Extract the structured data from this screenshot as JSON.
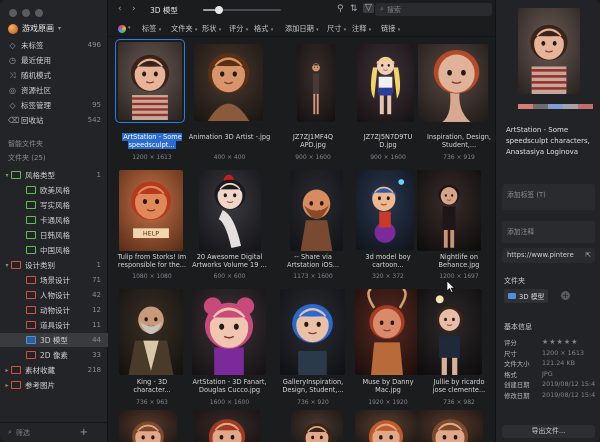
{
  "sidebar": {
    "library_name": "游戏原画",
    "nav": [
      {
        "label": "未标签",
        "count": "496",
        "icon": "tag"
      },
      {
        "label": "最近使用",
        "count": "",
        "icon": "clock"
      },
      {
        "label": "随机模式",
        "count": "",
        "icon": "shuffle"
      },
      {
        "label": "资源社区",
        "count": "",
        "icon": "globe"
      },
      {
        "label": "标签管理",
        "count": "95",
        "icon": "tag"
      },
      {
        "label": "回收站",
        "count": "542",
        "icon": "trash"
      }
    ],
    "smart_folders_title": "智能文件夹",
    "folders_title": "文件夹 (25)",
    "folders": [
      {
        "label": "风格类型",
        "count": "1",
        "arrow": "▾",
        "indent": 0,
        "color": "green"
      },
      {
        "label": "欧美风格",
        "count": "",
        "arrow": "",
        "indent": 1,
        "color": "green"
      },
      {
        "label": "写实风格",
        "count": "",
        "arrow": "",
        "indent": 1,
        "color": "green"
      },
      {
        "label": "卡通风格",
        "count": "",
        "arrow": "",
        "indent": 1,
        "color": "green"
      },
      {
        "label": "日韩风格",
        "count": "",
        "arrow": "",
        "indent": 1,
        "color": "green"
      },
      {
        "label": "中国风格",
        "count": "",
        "arrow": "",
        "indent": 1,
        "color": "green"
      },
      {
        "label": "设计类别",
        "count": "1",
        "arrow": "▾",
        "indent": 0,
        "color": "red"
      },
      {
        "label": "场景设计",
        "count": "71",
        "arrow": "",
        "indent": 1,
        "color": "red"
      },
      {
        "label": "人物设计",
        "count": "42",
        "arrow": "",
        "indent": 1,
        "color": "red"
      },
      {
        "label": "动物设计",
        "count": "12",
        "arrow": "",
        "indent": 1,
        "color": "red"
      },
      {
        "label": "道具设计",
        "count": "11",
        "arrow": "",
        "indent": 1,
        "color": "red"
      },
      {
        "label": "3D 模型",
        "count": "44",
        "arrow": "",
        "indent": 1,
        "color": "blue",
        "selected": true
      },
      {
        "label": "2D 像素",
        "count": "33",
        "arrow": "",
        "indent": 1,
        "color": "red"
      },
      {
        "label": "素材收藏",
        "count": "218",
        "arrow": "▸",
        "indent": 0,
        "color": "red"
      },
      {
        "label": "参考图片",
        "count": "",
        "arrow": "▸",
        "indent": 0,
        "color": "red"
      }
    ],
    "filter_placeholder": "筛选"
  },
  "topbar": {
    "folder_title": "3D 模型",
    "search_placeholder": "搜索",
    "thumb_size": 0.2
  },
  "filters": [
    "标签",
    "文件夹",
    "形状",
    "评分",
    "格式",
    "添加日期",
    "尺寸",
    "注释",
    "链接"
  ],
  "items": [
    {
      "caption": "ArtStation - Some\nspeedsculpt...",
      "dims": "1200 × 1613",
      "selected": true,
      "art": "a1"
    },
    {
      "caption": "Animation 3D Artist -.jpg",
      "dims": "400 × 400",
      "art": "a2"
    },
    {
      "caption": "JZ7ZJ1MF4Q\nAPD.jpg",
      "dims": "900 × 1600",
      "art": "a3"
    },
    {
      "caption": "JZ7ZJ5N7D9TU\nD.jpg",
      "dims": "900 × 1600",
      "art": "a4"
    },
    {
      "caption": "Inspiration, Design,\nStudent,...",
      "dims": "736 × 919",
      "art": "a5"
    },
    {
      "caption": "Tulip from Storks! Im\nresponsible for the...",
      "dims": "1080 × 1080",
      "art": "b1"
    },
    {
      "caption": "20 Awesome Digital\nArtworks Volume 19 ...",
      "dims": "600 × 600",
      "art": "b2"
    },
    {
      "caption": "-- Share via\nArtstation iOS...",
      "dims": "1173 × 1600",
      "art": "b3"
    },
    {
      "caption": "3d model boy\ncartoon...",
      "dims": "320 × 372",
      "art": "b4"
    },
    {
      "caption": "Nightlife on\nBehance.jpg",
      "dims": "1200 × 1697",
      "art": "b5"
    },
    {
      "caption": "King - 3D\ncharacter...",
      "dims": "736 × 963",
      "art": "c1"
    },
    {
      "caption": "ArtStation - 3D Fanart,\nDouglas Cucco.jpg",
      "dims": "1600 × 1600",
      "art": "c2"
    },
    {
      "caption": "GalleryInspiration,\nDesign, Student,...",
      "dims": "736 × 920",
      "art": "c3"
    },
    {
      "caption": "Muse by Danny\nMac.jpg",
      "dims": "1920 × 1920",
      "art": "c4"
    },
    {
      "caption": "Jullie by ricardo\njose clemente...",
      "dims": "736 × 982",
      "art": "c5"
    }
  ],
  "inspector": {
    "title": "ArtStation - Some speedsculpt characters, Anastasiya Loginova",
    "palette": [
      "#d47f75",
      "#6e6e70",
      "#7fa0cf",
      "#a5a3a5",
      "#c26f6c"
    ],
    "tags_placeholder": "添加标签 (T)",
    "notes_placeholder": "添加注释",
    "url": "https://www.pintere",
    "folder_label": "文件夹",
    "folder_chip": "3D 模型",
    "basic_info": "基本信息",
    "rows": [
      {
        "k": "评分",
        "v": "★★★★★"
      },
      {
        "k": "尺寸",
        "v": "1200 × 1613"
      },
      {
        "k": "文件大小",
        "v": "121.24 KB"
      },
      {
        "k": "格式",
        "v": "JPG"
      },
      {
        "k": "创建日期",
        "v": "2019/08/12 15:4"
      },
      {
        "k": "修改日期",
        "v": "2019/08/12 15:4"
      }
    ],
    "export_label": "导出文件..."
  },
  "colors": {
    "accent": "#2b7de9",
    "sidebar_bg": "#232427",
    "main_bg": "#1b1c1e"
  }
}
